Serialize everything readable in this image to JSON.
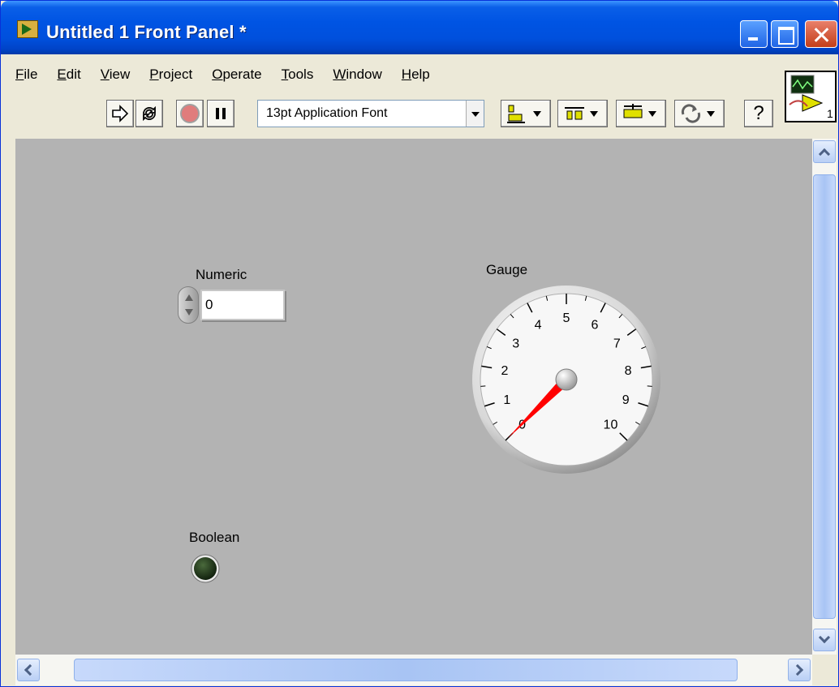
{
  "window": {
    "title": "Untitled 1 Front Panel *"
  },
  "menu": [
    {
      "label": "File",
      "u": "F",
      "rest": "ile"
    },
    {
      "label": "Edit",
      "u": "E",
      "rest": "dit"
    },
    {
      "label": "View",
      "u": "V",
      "rest": "iew"
    },
    {
      "label": "Project",
      "u": "P",
      "rest": "roject"
    },
    {
      "label": "Operate",
      "u": "O",
      "rest": "perate"
    },
    {
      "label": "Tools",
      "u": "T",
      "rest": "ools"
    },
    {
      "label": "Window",
      "u": "W",
      "rest": "indow"
    },
    {
      "label": "Help",
      "u": "H",
      "rest": "elp"
    }
  ],
  "toolbar": {
    "font_select_value": "13pt Application Font",
    "run_icon": "run-arrow-icon",
    "run_continuous_icon": "run-continuously-icon",
    "abort_icon": "abort-execution-icon",
    "pause_icon": "pause-icon",
    "align_icon": "align-objects-icon",
    "distribute_icon": "distribute-objects-icon",
    "resize_icon": "resize-objects-icon",
    "reorder_icon": "reorder-icon",
    "help_glyph": "?",
    "connector_pane_number": "1"
  },
  "panel": {
    "numeric": {
      "label": "Numeric",
      "value": "0"
    },
    "gauge": {
      "label": "Gauge",
      "min": 0,
      "max": 10,
      "value": 0,
      "ticks": [
        "0",
        "1",
        "2",
        "3",
        "4",
        "5",
        "6",
        "7",
        "8",
        "9",
        "10"
      ],
      "needle_color": "#ff0000"
    },
    "boolean": {
      "label": "Boolean",
      "state": false,
      "off_color": "#1f3a1a"
    }
  },
  "colors": {
    "titlebar": "#0054e3",
    "chrome": "#ece9d8",
    "panel_background": "#b3b3b3"
  }
}
